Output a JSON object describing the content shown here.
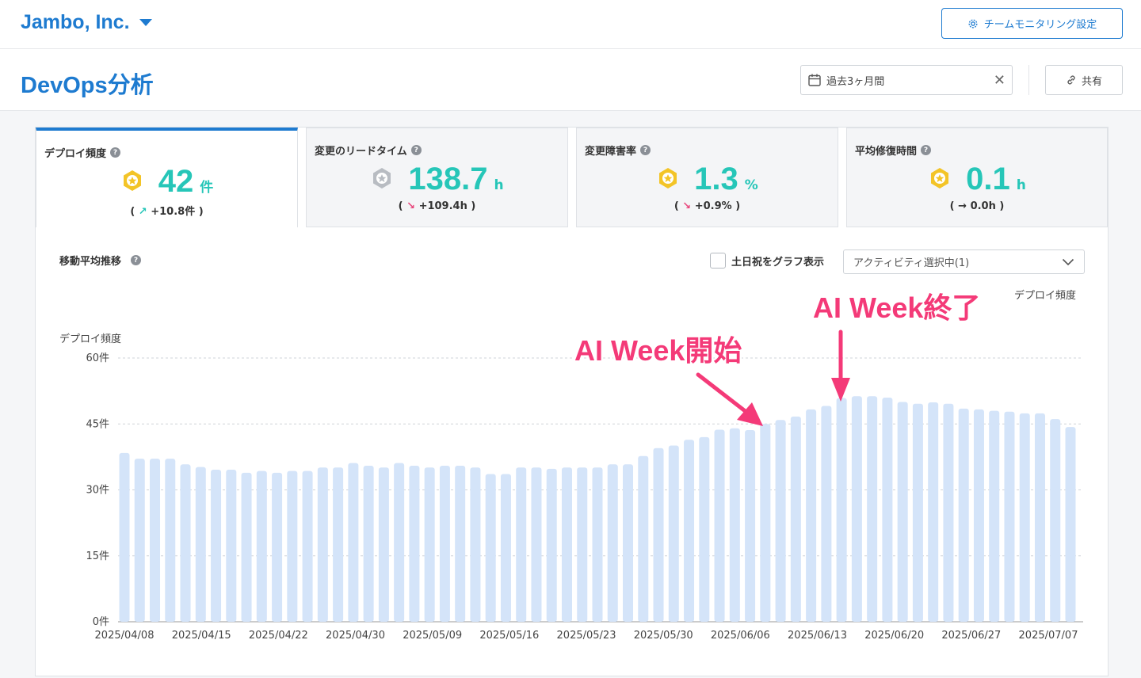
{
  "org": {
    "name": "Jambo, Inc."
  },
  "header": {
    "monitor_button": "チームモニタリング設定"
  },
  "page": {
    "title": "DevOps分析"
  },
  "date_filter": {
    "value": "過去3ヶ月間"
  },
  "share_button": "共有",
  "colors": {
    "accent": "#1e7bd0",
    "teal": "#26c6b8",
    "bar": "#d4e4f9",
    "annotation": "#f43a78"
  },
  "tabs": [
    {
      "label": "デプロイ頻度",
      "value": "42",
      "unit": "件",
      "delta": "+10.8件",
      "direction": "up",
      "medal": "gold",
      "active": true
    },
    {
      "label": "変更のリードタイム",
      "value": "138.7",
      "unit": "h",
      "delta": "+109.4h",
      "direction": "down",
      "medal": "silver",
      "active": false
    },
    {
      "label": "変更障害率",
      "value": "1.3",
      "unit": "%",
      "delta": "+0.9%",
      "direction": "down",
      "medal": "gold",
      "active": false
    },
    {
      "label": "平均修復時間",
      "value": "0.1",
      "unit": "h",
      "delta": "0.0h",
      "direction": "flat",
      "medal": "gold",
      "active": false
    }
  ],
  "chart_section": {
    "title": "移動平均推移",
    "weekend_label": "土日祝をグラフ表示",
    "activity_select": "アクティビティ選択中(1)"
  },
  "chart_data": {
    "type": "bar",
    "ylabel": "デプロイ頻度",
    "legend": "デプロイ頻度",
    "legend_position": "top-right",
    "ylim": [
      0,
      60
    ],
    "yticks": [
      "0件",
      "15件",
      "30件",
      "45件",
      "60件"
    ],
    "grid": true,
    "x_labels": [
      "2025/04/08",
      "2025/04/15",
      "2025/04/22",
      "2025/04/30",
      "2025/05/09",
      "2025/05/16",
      "2025/05/23",
      "2025/05/30",
      "2025/06/06",
      "2025/06/13",
      "2025/06/20",
      "2025/06/27",
      "2025/07/07"
    ],
    "values": [
      38.4,
      37.1,
      37.1,
      37.1,
      35.8,
      35.2,
      34.6,
      34.6,
      33.9,
      34.3,
      33.9,
      34.3,
      34.3,
      35.1,
      35.1,
      36.1,
      35.5,
      35.1,
      36.1,
      35.5,
      35.1,
      35.5,
      35.5,
      35.1,
      33.6,
      33.6,
      35.1,
      35.1,
      34.8,
      35.1,
      35.1,
      35.1,
      35.8,
      35.8,
      37.7,
      39.5,
      40.1,
      41.4,
      42.0,
      43.7,
      44.0,
      43.6,
      45.0,
      45.9,
      46.7,
      48.3,
      49.1,
      50.9,
      51.3,
      51.3,
      51.0,
      50.0,
      49.6,
      49.9,
      49.6,
      48.5,
      48.3,
      48.0,
      47.8,
      47.4,
      47.4,
      46.1,
      44.3
    ],
    "annotations": [
      {
        "text": "AI Week開始"
      },
      {
        "text": "AI Week終了"
      }
    ]
  }
}
